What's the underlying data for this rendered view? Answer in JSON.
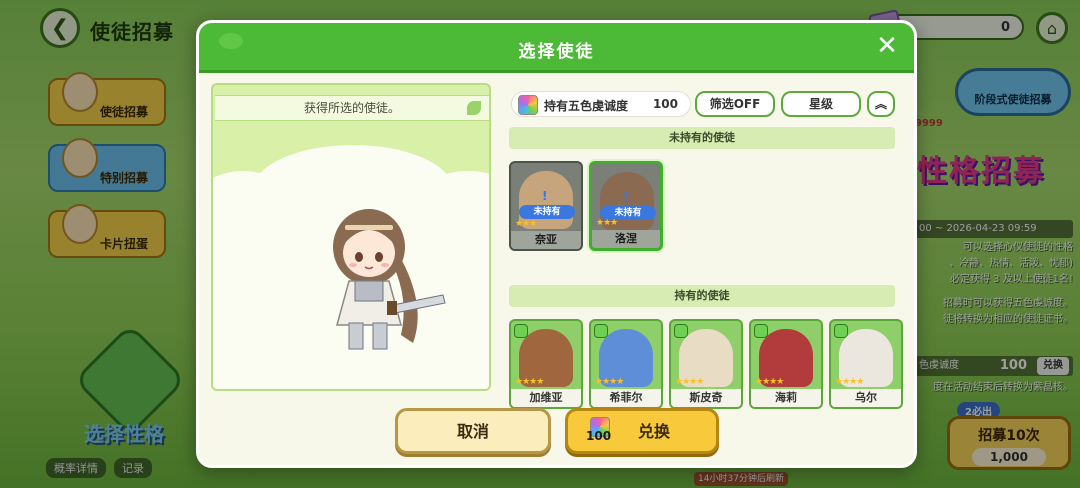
{
  "page": {
    "title": "使徒招募",
    "currency_value": "0",
    "side_menu": [
      {
        "label": "使徒招募"
      },
      {
        "label": "特别招募"
      },
      {
        "label": "卡片扭蛋"
      }
    ],
    "select_trait_label": "选择性格",
    "bottom_links": [
      "概率详情",
      "记录"
    ],
    "right_panel": {
      "stage_button": "阶段式使徒招募",
      "value_9999": "9999",
      "banner_title": "性格招募",
      "date_range": "00 ~ 2026-04-23 09:59",
      "desc_lines": [
        "可以选择心仪使徒的性格",
        "、冷静、热情、活泼、忧郁)",
        "必定获得 3 及以上使徒1名!"
      ],
      "desc2_lines": [
        "招募时可以获得五色虔诚度。",
        "徒将转换为相应的使徒证书。"
      ],
      "count_label": "色虔诚度",
      "count_value": "100",
      "count_exchange": "兑换",
      "count_note": "度在活动结束后转换为紫晶核。",
      "must_badge": "2必出",
      "recruit_label": "招募10次",
      "recruit_cost": "1,000"
    },
    "refresh_note": "14小时37分钟后刷新"
  },
  "modal": {
    "title": "选择使徒",
    "close": "✕",
    "preview_caption": "获得所选的使徒。",
    "owned_label": "持有五色虔诚度",
    "owned_value": "100",
    "filter_label": "筛选OFF",
    "star_label": "星级",
    "sort_icon": "︽",
    "section_unowned": "未持有的使徒",
    "section_owned": "持有的使徒",
    "unowned_status": "未持有",
    "unowned_cards": [
      {
        "name": "奈亚",
        "color": "#c7a57c",
        "selected": false
      },
      {
        "name": "洛涅",
        "color": "#8b6a52",
        "selected": true
      }
    ],
    "owned_cards": [
      {
        "name": "加维亚",
        "color": "#a0673f"
      },
      {
        "name": "希菲尔",
        "color": "#5f8ed8"
      },
      {
        "name": "斯皮奇",
        "color": "#e8dcc4"
      },
      {
        "name": "海莉",
        "color": "#b23c3c"
      },
      {
        "name": "乌尔",
        "color": "#ece7de"
      }
    ],
    "cancel_label": "取消",
    "exchange_label": "兑换",
    "exchange_cost": "100"
  }
}
